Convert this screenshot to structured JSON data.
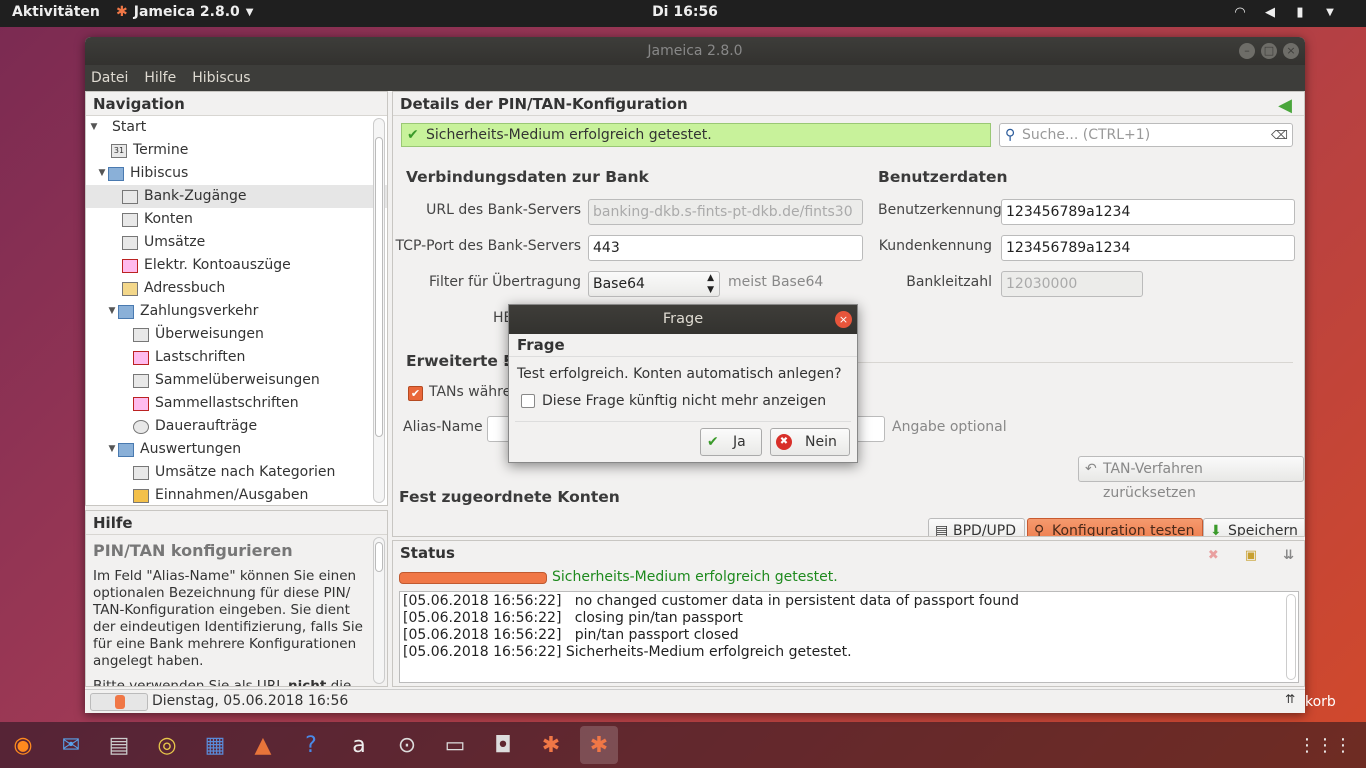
{
  "topbar": {
    "activities": "Aktivitäten",
    "app_name": "Jameica 2.8.0",
    "clock": "Di 16:56"
  },
  "window": {
    "title": "Jameica 2.8.0",
    "menu": [
      "Datei",
      "Hilfe",
      "Hibiscus"
    ]
  },
  "navigation": {
    "title": "Navigation",
    "items": [
      {
        "label": "Start",
        "icon": "triangle-icon"
      },
      {
        "label": "Termine",
        "icon": "calendar-icon"
      },
      {
        "label": "Hibiscus",
        "icon": "folder-icon"
      },
      {
        "label": "Bank-Zugänge",
        "icon": "bank-access-icon"
      },
      {
        "label": "Konten",
        "icon": "account-icon"
      },
      {
        "label": "Umsätze",
        "icon": "transactions-icon"
      },
      {
        "label": "Elektr. Kontoauszüge",
        "icon": "pdf-icon"
      },
      {
        "label": "Adressbuch",
        "icon": "addressbook-icon"
      },
      {
        "label": "Zahlungsverkehr",
        "icon": "folder-icon"
      },
      {
        "label": "Überweisungen",
        "icon": "transfer-icon"
      },
      {
        "label": "Lastschriften",
        "icon": "debit-icon"
      },
      {
        "label": "Sammelüberweisungen",
        "icon": "bulk-transfer-icon"
      },
      {
        "label": "Sammellastschriften",
        "icon": "bulk-debit-icon"
      },
      {
        "label": "Daueraufträge",
        "icon": "standing-order-icon"
      },
      {
        "label": "Auswertungen",
        "icon": "folder-icon"
      },
      {
        "label": "Umsätze nach Kategorien",
        "icon": "category-chart-icon"
      },
      {
        "label": "Einnahmen/Ausgaben",
        "icon": "income-expense-icon"
      }
    ]
  },
  "help": {
    "title": "Hilfe",
    "heading": "PIN/TAN konfigurieren",
    "text1": "Im Feld \"Alias-Name\" können Sie einen optionalen Bezeichnung für diese PIN/ TAN-Konfiguration eingeben. Sie dient der eindeutigen Identifizierung, falls Sie für eine Bank mehrere Konfigurationen angelegt haben.",
    "text2_pre": "Bitte verwenden Sie als URL ",
    "text2_bold": "nicht",
    "text2_post": " die"
  },
  "statusbar": {
    "datetime": "Dienstag, 05.06.2018 16:56"
  },
  "details": {
    "title": "Details der PIN/TAN-Konfiguration",
    "success_msg": "Sicherheits-Medium erfolgreich getestet.",
    "search_placeholder": "Suche...  (CTRL+1)",
    "section_connection": "Verbindungsdaten zur Bank",
    "section_user": "Benutzerdaten",
    "url_label": "URL des Bank-Servers",
    "url_value": "banking-dkb.s-fints-pt-dkb.de/fints30",
    "port_label": "TCP-Port des Bank-Servers",
    "port_value": "443",
    "filter_label": "Filter für Übertragung",
    "filter_value": "Base64",
    "filter_hint": "meist Base64",
    "hbci_label_partial": "HB",
    "user_id_label": "Benutzerkennung",
    "user_id_value": "123456789a1234",
    "customer_id_label": "Kundenkennung",
    "customer_id_value": "123456789a1234",
    "blz_label": "Bankleitzahl",
    "blz_value": "12030000",
    "section_advanced_partial": "Erweiterte Ei",
    "tan_checkbox_partial": "TANs währe",
    "alias_label": "Alias-Name",
    "alias_hint": "Angabe optional",
    "reset_tan_button": "TAN-Verfahren zurücksetzen",
    "section_accounts": "Fest zugeordnete Konten",
    "bpd_button": "BPD/UPD",
    "test_button": "Konfiguration testen",
    "save_button": "Speichern"
  },
  "status": {
    "title": "Status",
    "progress_msg": "Sicherheits-Medium erfolgreich getestet.",
    "progress_fraction": 1.0,
    "log": [
      "[05.06.2018 16:56:22]   no changed customer data in persistent data of passport found",
      "[05.06.2018 16:56:22]   closing pin/tan passport",
      "[05.06.2018 16:56:22]   pin/tan passport closed",
      "[05.06.2018 16:56:22] Sicherheits-Medium erfolgreich getestet."
    ]
  },
  "dialog": {
    "title": "Frage",
    "heading": "Frage",
    "question": "Test erfolgreich. Konten automatisch anlegen?",
    "checkbox_label": "Diese Frage künftig nicht mehr anzeigen",
    "yes": "Ja",
    "no": "Nein"
  },
  "desktop": {
    "trash_label_partial": "korb"
  },
  "colors": {
    "success_bg": "#c8f29b",
    "accent_orange": "#f07746",
    "status_green": "#1e8a1e"
  }
}
